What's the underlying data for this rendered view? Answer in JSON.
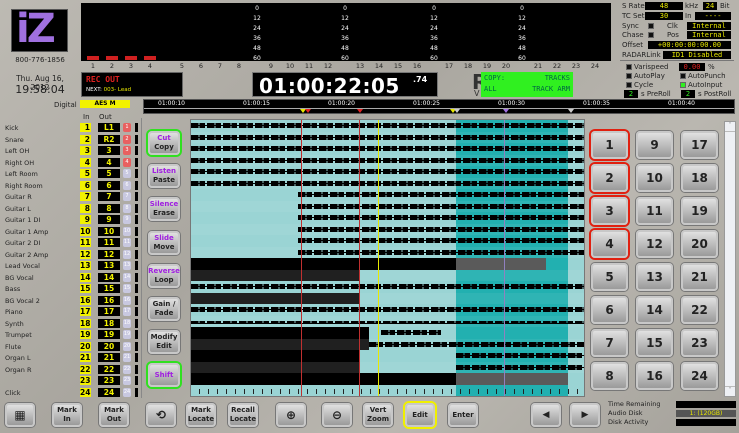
{
  "logo": {
    "text": "iZ",
    "phone": "800-776-1856"
  },
  "clock": {
    "date": "Thu. Aug 16, 2012",
    "time": "19:58:04"
  },
  "meters": {
    "scale": [
      "0",
      "12",
      "24",
      "36",
      "48",
      "60"
    ],
    "channels": [
      "1",
      "2",
      "3",
      "4",
      "5",
      "6",
      "7",
      "8",
      "9",
      "10",
      "11",
      "12",
      "13",
      "14",
      "15",
      "16",
      "17",
      "18",
      "19",
      "20",
      "21",
      "22",
      "23",
      "24"
    ],
    "active_channels": 4
  },
  "rec_status": {
    "mode": "REC OUT",
    "next_label": "NEXT:",
    "next_value": "003- Lead"
  },
  "timecode": {
    "main": "01:00:22:05",
    "frames": ".74"
  },
  "product_label": "R",
  "product_sub": "V",
  "mode_box": {
    "line1_left": "COPY:",
    "line1_right": "TRACKS",
    "line2_left": "ALL",
    "line2_right": "TRACK ARM"
  },
  "settings": {
    "srate_label": "S Rate",
    "srate": "48",
    "khz": "kHz",
    "bits": "24",
    "bit_label": "Bit",
    "tcset_label": "TC Set",
    "tcset": "30",
    "in_label": "In",
    "in_value": "----",
    "sync_label": "Sync",
    "clk_label": "Clk",
    "clk": "Internal",
    "chase_label": "Chase",
    "pos_label": "Pos",
    "pos": "Internal",
    "offset_label": "Offset",
    "offset": "+00:00:00:00.00",
    "link_label": "RADARLink",
    "link": "ID1 Disabled",
    "varispeed_label": "Varispeed",
    "varispeed": "0.00",
    "pct": "%",
    "autoplay": "AutoPlay",
    "autopunch": "AutoPunch",
    "cycle": "Cycle",
    "autoinput": "AutoInput",
    "preroll": "2",
    "preroll_label": "s PreRoll",
    "postroll": "2",
    "postroll_label": "s PostRoll"
  },
  "input": {
    "label": "Digital",
    "value": "AES M"
  },
  "track_headers": {
    "in": "In",
    "out": "Out"
  },
  "tracks": [
    {
      "name": "Kick",
      "in": "1",
      "out": "L1"
    },
    {
      "name": "Snare",
      "in": "2",
      "out": "R2"
    },
    {
      "name": "Left OH",
      "in": "3",
      "out": "3"
    },
    {
      "name": "Right OH",
      "in": "4",
      "out": "4"
    },
    {
      "name": "Left Room",
      "in": "5",
      "out": "5"
    },
    {
      "name": "Right Room",
      "in": "6",
      "out": "6"
    },
    {
      "name": "Guitar R",
      "in": "7",
      "out": "7"
    },
    {
      "name": "Guitar L",
      "in": "8",
      "out": "8"
    },
    {
      "name": "Guitar 1 DI",
      "in": "9",
      "out": "9"
    },
    {
      "name": "Guitar 1 Amp",
      "in": "10",
      "out": "10"
    },
    {
      "name": "Guitar 2 DI",
      "in": "11",
      "out": "11"
    },
    {
      "name": "Guitar 2 Amp",
      "in": "12",
      "out": "12"
    },
    {
      "name": "Lead Vocal",
      "in": "13",
      "out": "13"
    },
    {
      "name": "BG Vocal",
      "in": "14",
      "out": "14"
    },
    {
      "name": "Bass",
      "in": "15",
      "out": "15"
    },
    {
      "name": "BG Vocal 2",
      "in": "16",
      "out": "16"
    },
    {
      "name": "Piano",
      "in": "17",
      "out": "17"
    },
    {
      "name": "Synth",
      "in": "18",
      "out": "18"
    },
    {
      "name": "Trumpet",
      "in": "19",
      "out": "19"
    },
    {
      "name": "Flute",
      "in": "20",
      "out": "20"
    },
    {
      "name": "Organ L",
      "in": "21",
      "out": "21"
    },
    {
      "name": "Organ R",
      "in": "22",
      "out": "22"
    },
    {
      "name": "",
      "in": "23",
      "out": "23"
    },
    {
      "name": "Click",
      "in": "24",
      "out": "24"
    }
  ],
  "armed_tracks": [
    1,
    2,
    3,
    4
  ],
  "ruler": [
    "01:00:10",
    "01:00:15",
    "01:00:20",
    "01:00:25",
    "01:00:30",
    "01:00:35",
    "01:00:40"
  ],
  "edit_buttons": [
    {
      "top": "Cut",
      "bottom": "Copy",
      "active": true
    },
    {
      "top": "Listen",
      "bottom": "Paste"
    },
    {
      "top": "Silence",
      "bottom": "Erase"
    },
    {
      "top": "Slide",
      "bottom": "Move"
    },
    {
      "top": "Reverse",
      "bottom": "Loop"
    },
    {
      "top": "",
      "bottom": "Gain / Fade"
    },
    {
      "top": "",
      "bottom": "Modify Edit"
    },
    {
      "top": "Shift",
      "bottom": "",
      "active": true
    }
  ],
  "track_select": [
    "1",
    "2",
    "3",
    "4",
    "5",
    "6",
    "7",
    "8",
    "9",
    "10",
    "11",
    "12",
    "13",
    "14",
    "15",
    "16",
    "17",
    "18",
    "19",
    "20",
    "21",
    "22",
    "23",
    "24"
  ],
  "toolbar": [
    {
      "label": "",
      "name": "grid-view-button",
      "icon": "grid"
    },
    {
      "label": "Mark In",
      "name": "mark-in-button"
    },
    {
      "label": "Mark Out",
      "name": "mark-out-button"
    },
    {
      "label": "",
      "name": "loop-button",
      "icon": "loop"
    },
    {
      "label": "Mark Locate",
      "name": "mark-locate-button"
    },
    {
      "label": "Recall Locate",
      "name": "recall-locate-button"
    },
    {
      "label": "",
      "name": "zoom-in-button",
      "icon": "zoom-in"
    },
    {
      "label": "",
      "name": "zoom-out-button",
      "icon": "zoom-out"
    },
    {
      "label": "Vert Zoom",
      "name": "vert-zoom-button"
    },
    {
      "label": "Edit",
      "name": "edit-button",
      "active": true
    },
    {
      "label": "Enter",
      "name": "enter-button"
    },
    {
      "label": "◀",
      "name": "prev-button",
      "icon": "prev"
    },
    {
      "label": "▶",
      "name": "next-button",
      "icon": "next"
    }
  ],
  "status": {
    "time_remaining": "Time Remaining",
    "audio_disk": "Audio Disk",
    "disk_value": "1: (120GB)",
    "disk_activity": "Disk Activity"
  },
  "colors": {
    "accent": "#a070e0",
    "lcd": "#e8e800",
    "green": "#30f020",
    "teal": "#22b0b0",
    "light_teal": "#9ad4d4"
  }
}
